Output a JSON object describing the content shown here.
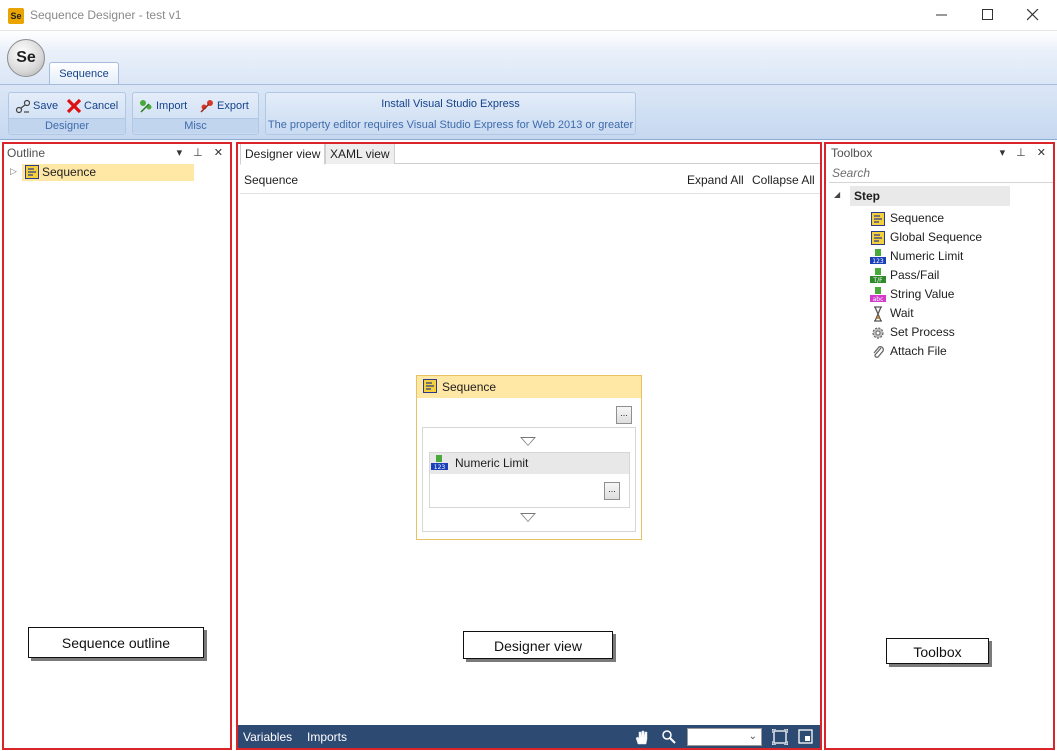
{
  "window": {
    "icon_text": "Se",
    "title": "Sequence Designer - test v1",
    "minimize_glyph": "—",
    "maximize_glyph": "☐",
    "close_glyph": "✕"
  },
  "ribbon": {
    "orb_text": "Se",
    "tab_label": "Sequence",
    "groups": {
      "designer": {
        "label": "Designer",
        "save_label": "Save",
        "cancel_label": "Cancel"
      },
      "misc": {
        "label": "Misc",
        "import_label": "Import",
        "export_label": "Export"
      },
      "notice": {
        "install_label": "Install Visual Studio Express",
        "message": "The property editor requires Visual Studio Express for Web 2013 or greater"
      }
    }
  },
  "outline": {
    "title": "Outline",
    "header_buttons": "▾ ⊥ ✕",
    "tree_expander": "▷",
    "root_item": "Sequence",
    "callout": "Sequence outline"
  },
  "designer": {
    "tabs": [
      "Designer view",
      "XAML view"
    ],
    "breadcrumb": "Sequence",
    "expand_all": "Expand All",
    "collapse_all": "Collapse All",
    "sequence_title": "Sequence",
    "activity_title": "Numeric Limit",
    "ellipsis": "...",
    "callout": "Designer view",
    "bottom": {
      "variables": "Variables",
      "imports": "Imports",
      "zoom_dropdown": "⌄"
    }
  },
  "toolbox": {
    "title": "Toolbox",
    "header_buttons": "▾ ⊥ ✕",
    "search_placeholder": "Search",
    "category_expander": "◢",
    "category": "Step",
    "items": [
      {
        "label": "Sequence",
        "icon": "sequence-icon"
      },
      {
        "label": "Global Sequence",
        "icon": "global-sequence-icon"
      },
      {
        "label": "Numeric Limit",
        "icon": "numeric-limit-icon"
      },
      {
        "label": "Pass/Fail",
        "icon": "pass-fail-icon"
      },
      {
        "label": "String Value",
        "icon": "string-value-icon"
      },
      {
        "label": "Wait",
        "icon": "hourglass-icon"
      },
      {
        "label": "Set Process",
        "icon": "gear-icon"
      },
      {
        "label": "Attach File",
        "icon": "paperclip-icon"
      }
    ],
    "callout": "Toolbox"
  },
  "colors": {
    "highlight_frame": "#d9242a",
    "selection": "#ffe8a6",
    "bottom_bar": "#2d4a73",
    "ribbon_text": "#15428b"
  }
}
